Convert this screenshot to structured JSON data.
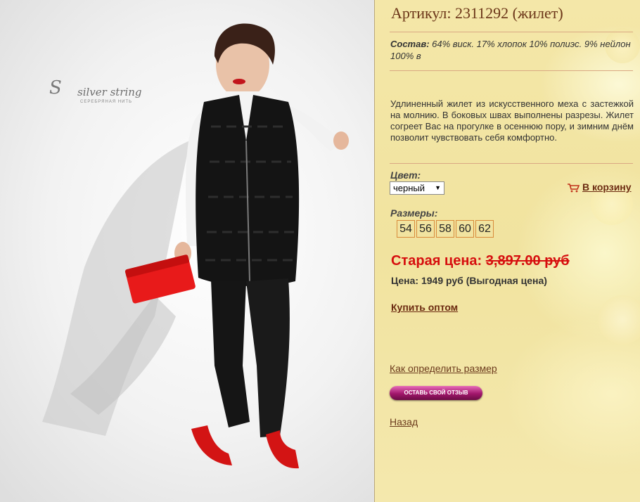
{
  "product": {
    "title": "Артикул: 2311292 (жилет)",
    "composition_label": "Состав:",
    "composition_text": " 64% виск. 17% хлопок 10% полиэс. 9% нейлон 100% в",
    "description": "Удлиненный жилет из искусственного меха с застежкой на молнию. В боковых швах выполнены разрезы. Жилет согреет Вас на прогулке в осеннюю пору, и зимним днём позволит чувствовать себя комфортно."
  },
  "photo": {
    "logo_name": "silver string",
    "logo_sub": "СЕРЕБРЯНАЯ НИТЬ"
  },
  "color": {
    "label": "Цвет:",
    "selected": "черный"
  },
  "cart": {
    "label": "В корзину"
  },
  "sizes": {
    "label": "Размеры:",
    "items": [
      "54",
      "56",
      "58",
      "60",
      "62"
    ]
  },
  "pricing": {
    "old_label": "Старая цена: ",
    "old_value": "3,897.00 руб",
    "current": "Цена: 1949 руб (Выгодная цена)"
  },
  "links": {
    "buy_wholesale": "Купить оптом",
    "size_guide": "Как определить размер",
    "review_button": "ОСТАВЬ СВОЙ ОТЗЫВ",
    "back": "Назад"
  }
}
